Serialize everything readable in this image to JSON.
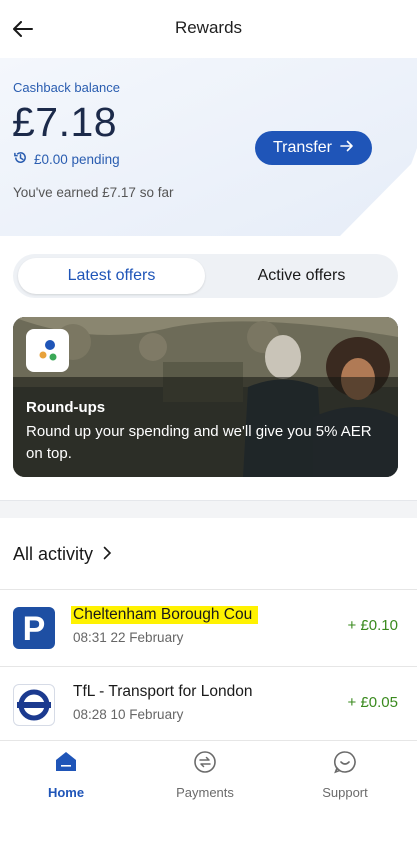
{
  "header": {
    "title": "Rewards"
  },
  "balance": {
    "label": "Cashback balance",
    "amount": "£7.18",
    "pending": "£0.00 pending",
    "earned": "You've earned £7.17 so far",
    "transfer_label": "Transfer"
  },
  "tabs": [
    {
      "label": "Latest offers",
      "selected": true
    },
    {
      "label": "Active offers",
      "selected": false
    }
  ],
  "promo": {
    "title": "Round-ups",
    "description": "Round up your spending and we'll give you 5% AER on top."
  },
  "activity": {
    "title": "All activity",
    "items": [
      {
        "merchant": "Cheltenham Borough Cou",
        "datetime": "08:31 22 February",
        "amount": "+ £0.10",
        "icon": "parking-icon"
      },
      {
        "merchant": "TfL - Transport for London",
        "datetime": "08:28 10 February",
        "amount": "+ £0.05",
        "icon": "tfl-roundel-icon"
      }
    ]
  },
  "nav": [
    {
      "label": "Home",
      "icon": "home-icon",
      "active": true
    },
    {
      "label": "Payments",
      "icon": "payments-icon",
      "active": false
    },
    {
      "label": "Support",
      "icon": "support-icon",
      "active": false
    }
  ],
  "colors": {
    "accent": "#1f55b8",
    "positive": "#3a8a1e",
    "highlight": "#fff200"
  }
}
